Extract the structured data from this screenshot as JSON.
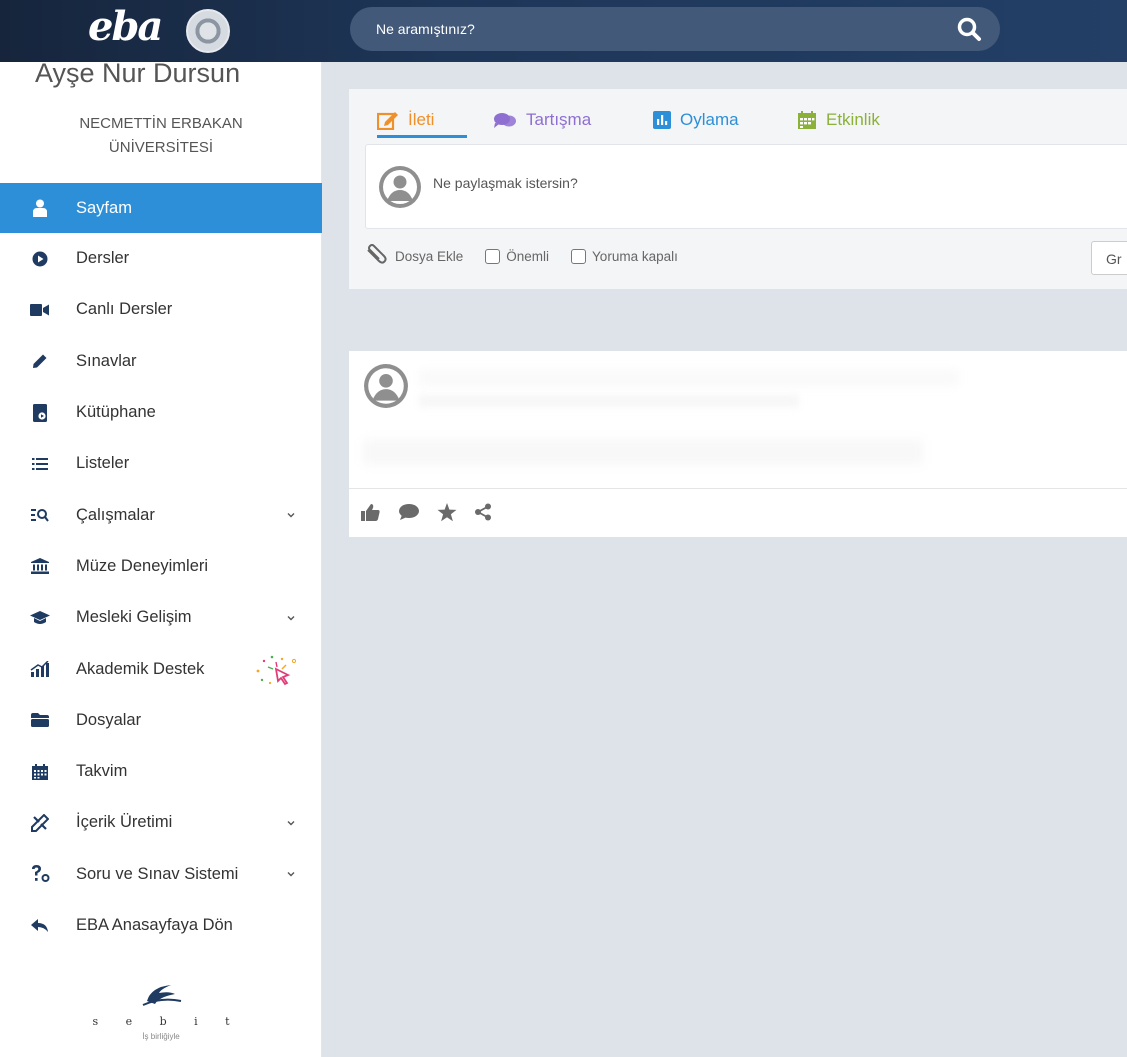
{
  "header": {
    "logo": "eba",
    "search_placeholder": "Ne aramıştınız?"
  },
  "profile": {
    "name": "Ayşe Nur Dursun",
    "school_line1": "NECMETTİN ERBAKAN",
    "school_line2": "ÜNİVERSİTESİ"
  },
  "sidebar": {
    "items": [
      {
        "label": "Sayfam",
        "icon": "user-icon"
      },
      {
        "label": "Dersler",
        "icon": "play-circle-icon"
      },
      {
        "label": "Canlı Dersler",
        "icon": "video-camera-icon"
      },
      {
        "label": "Sınavlar",
        "icon": "pencil-icon"
      },
      {
        "label": "Kütüphane",
        "icon": "library-icon"
      },
      {
        "label": "Listeler",
        "icon": "list-icon"
      },
      {
        "label": "Çalışmalar",
        "icon": "search-list-icon"
      },
      {
        "label": "Müze Deneyimleri",
        "icon": "museum-icon"
      },
      {
        "label": "Mesleki Gelişim",
        "icon": "graduation-cap-icon"
      },
      {
        "label": "Akademik Destek",
        "icon": "chart-icon"
      },
      {
        "label": "Dosyalar",
        "icon": "folder-icon"
      },
      {
        "label": "Takvim",
        "icon": "calendar-icon"
      },
      {
        "label": "İçerik Üretimi",
        "icon": "pen-ruler-icon"
      },
      {
        "label": "Soru ve Sınav Sistemi",
        "icon": "question-icon"
      },
      {
        "label": "EBA Anasayfaya Dön",
        "icon": "reply-icon"
      }
    ],
    "partner_word": "s e b i t",
    "partner_sub": "İş birliğiyle"
  },
  "composer": {
    "tabs": [
      {
        "label": "İleti",
        "color": "#f0902a"
      },
      {
        "label": "Tartışma",
        "color": "#8e6fd1"
      },
      {
        "label": "Oylama",
        "color": "#2d8fd8"
      },
      {
        "label": "Etkinlik",
        "color": "#8bb13a"
      }
    ],
    "placeholder": "Ne paylaşmak istersin?",
    "attach_label": "Dosya Ekle",
    "important_label": "Önemli",
    "comments_closed_label": "Yoruma kapalı",
    "group_button_label": "Gr"
  },
  "colors": {
    "accent": "#2d8fd8",
    "header_bg": "#1e3658",
    "page_bg": "#dde3e8"
  }
}
